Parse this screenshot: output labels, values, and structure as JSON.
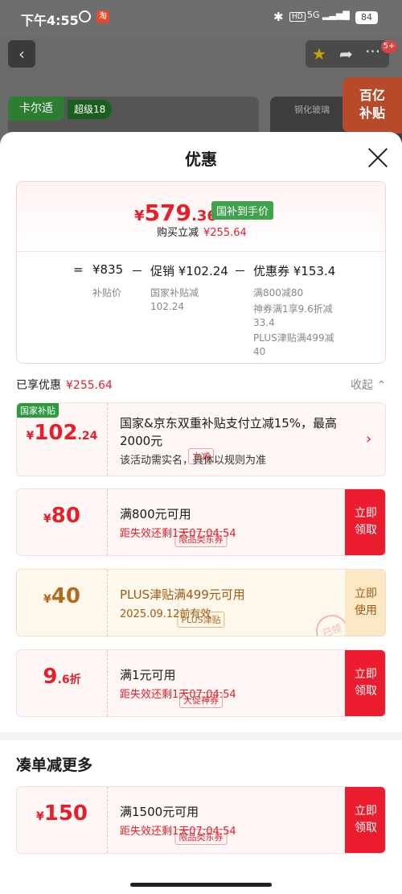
{
  "status": {
    "time": "下午4:55",
    "network": "5G",
    "battery": "84"
  },
  "background": {
    "brand": "卡尔适",
    "super": "超级18",
    "right_text": "钢化玻璃",
    "subsidy_line1": "百亿",
    "subsidy_line2": "补贴",
    "badge": "5+"
  },
  "sheet": {
    "title": "优惠"
  },
  "summary": {
    "price_yen": "¥",
    "price_int": "579",
    "price_dec": ".36",
    "price_tag": "国补到手价",
    "buy_label": "购买立减",
    "buy_value": "¥255.64",
    "calc": {
      "eq": "=",
      "base": "¥835",
      "base_label": "补贴价",
      "minus1": "－",
      "promo": "促销 ¥102.24",
      "promo_sub1": "国家补贴减",
      "promo_sub2": "102.24",
      "minus2": "－",
      "coupon": "优惠券 ¥153.4",
      "coupon_sub1": "满800减80",
      "coupon_sub2": "神券满1享9.6折减",
      "coupon_sub3": "33.4",
      "coupon_sub4": "PLUS津贴满499减",
      "coupon_sub5": "40"
    }
  },
  "shared": {
    "label": "已享优惠",
    "value": "¥255.64",
    "collapse": "收起"
  },
  "cards": [
    {
      "tag": "国家补贴",
      "yen": "¥",
      "amount": "102",
      "decimal": ".24",
      "label": "立减",
      "main1": "国家&京东双重补贴支付立减15%，最高",
      "main2": "2000元",
      "sub": "该活动需实名，具体以规则为准"
    },
    {
      "yen": "¥",
      "amount": "80",
      "label": "限品类东券",
      "main": "满800元可用",
      "sub": "距失效还剩1天07:04:54",
      "btn1": "立即",
      "btn2": "领取"
    },
    {
      "yen": "¥",
      "amount": "40",
      "label": "PLUS津贴",
      "main": "PLUS津贴满499元可用",
      "sub": "2025.09.12前有效",
      "btn1": "立即",
      "btn2": "使用",
      "stamp": "已领"
    },
    {
      "amount": "9",
      "decimal": ".6折",
      "label": "大促神券",
      "main": "满1元可用",
      "sub": "距失效还剩1天07:04:54",
      "btn1": "立即",
      "btn2": "领取"
    }
  ],
  "more": {
    "title": "凑单减更多",
    "card": {
      "yen": "¥",
      "amount": "150",
      "label": "限品类东券",
      "main": "满1500元可用",
      "sub": "距失效还剩1天07:04:54",
      "btn1": "立即",
      "btn2": "领取"
    }
  }
}
